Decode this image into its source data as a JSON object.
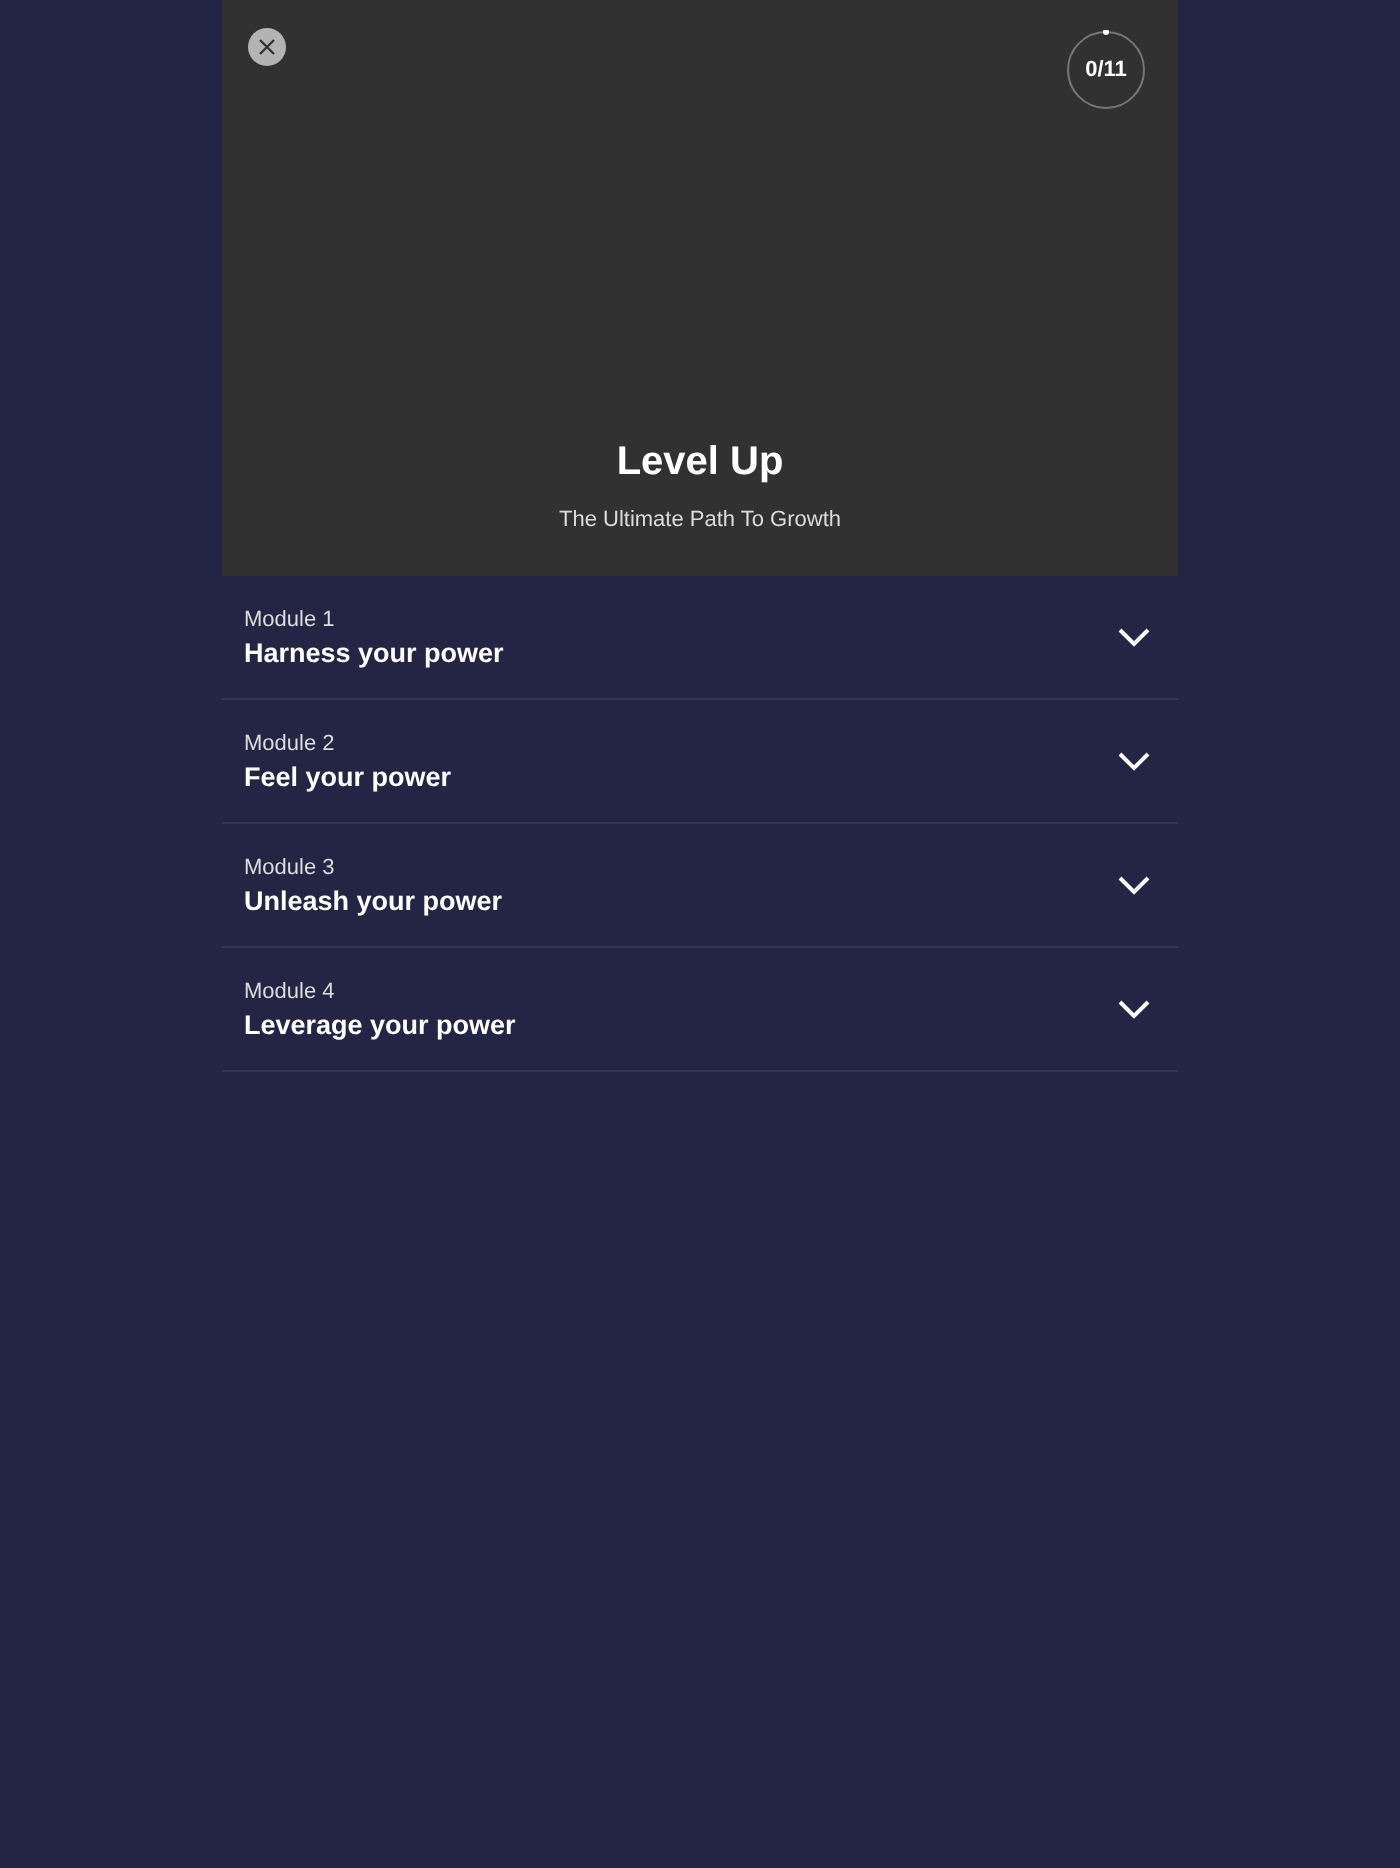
{
  "header": {
    "title": "Level Up",
    "subtitle": "The Ultimate Path To Growth",
    "progress": {
      "label": "0/11"
    }
  },
  "modules": [
    {
      "number": "Module 1",
      "title": "Harness your power",
      "expanded": false
    },
    {
      "number": "Module 2",
      "title": "Feel your power",
      "expanded": false
    },
    {
      "number": "Module 3",
      "title": "Unleash your power",
      "expanded": false
    },
    {
      "number": "Module 4",
      "title": "Leverage your power",
      "expanded": false
    }
  ]
}
